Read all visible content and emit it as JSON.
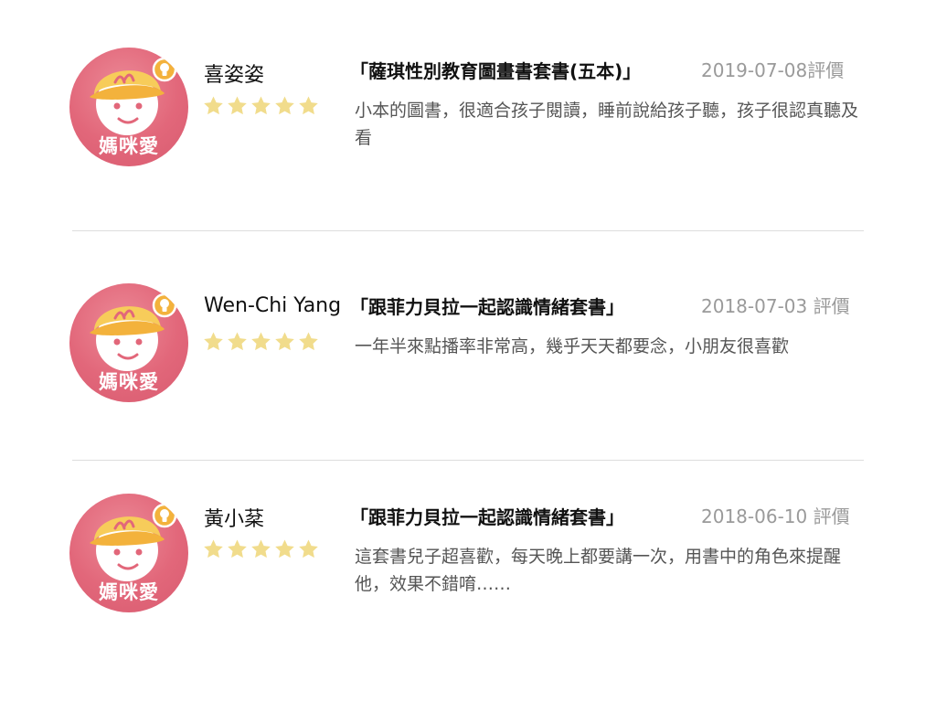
{
  "reviews": [
    {
      "avatar_label": "媽咪愛",
      "reviewer": "喜姿姿",
      "rating": 5,
      "product": "「薩琪性別教育圖畫書套書(五本)」",
      "date": "2019-07-08評價",
      "text": "小本的圖書，很適合孩子閱讀，睡前說給孩子聽，孩子很認真聽及看"
    },
    {
      "avatar_label": "媽咪愛",
      "reviewer": "Wen-Chi Yang",
      "rating": 5,
      "product": "「跟菲力貝拉一起認識情緒套書」",
      "date": "2018-07-03 評價",
      "text": "一年半來點播率非常高，幾乎天天都要念，小朋友很喜歡"
    },
    {
      "avatar_label": "媽咪愛",
      "reviewer": "黃小棻",
      "rating": 5,
      "product": "「跟菲力貝拉一起認識情緒套書」",
      "date": "2018-06-10 評價",
      "text": "這套書兒子超喜歡，每天晚上都要講一次，用書中的角色來提醒他，效果不錯唷……"
    }
  ],
  "colors": {
    "avatar_bg": "#e2677a",
    "hat": "#f7cc5a",
    "star": "#f1dc8c",
    "divider": "#dddddd",
    "date_text": "#9a9a9a",
    "body_text": "#555555"
  },
  "icons": {
    "avatar": "baby-face-icon",
    "badge": "lightbulb-badge-icon",
    "rating": "star-icon"
  }
}
